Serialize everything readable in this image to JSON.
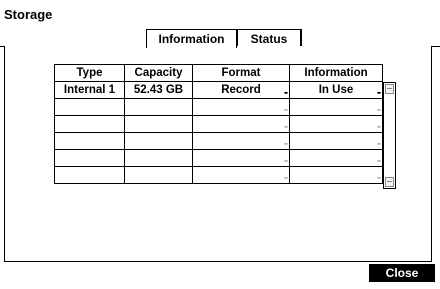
{
  "window": {
    "title": "Storage"
  },
  "tabs": [
    {
      "label": "Information",
      "active": true
    },
    {
      "label": "Status",
      "active": false
    }
  ],
  "table": {
    "headers": [
      "Type",
      "Capacity",
      "Format",
      "Information"
    ],
    "rows": [
      [
        "Internal 1",
        "52.43 GB",
        "Record",
        "In Use"
      ],
      [
        "",
        "",
        "",
        ""
      ],
      [
        "",
        "",
        "",
        ""
      ],
      [
        "",
        "",
        "",
        ""
      ],
      [
        "",
        "",
        "",
        ""
      ],
      [
        "",
        "",
        "",
        ""
      ]
    ]
  },
  "footer": {
    "close_label": "Close"
  },
  "icons": {
    "dropdown": "dropdown-indicator-icon",
    "scroll_up": "scroll-up-icon",
    "scroll_down": "scroll-down-icon"
  }
}
